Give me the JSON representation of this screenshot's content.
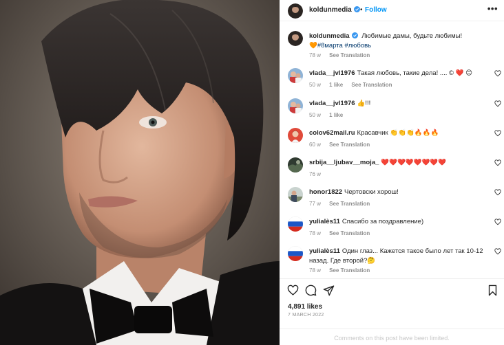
{
  "post": {
    "username": "koldunmedia",
    "follow_label": "Follow",
    "dot": "•",
    "more_label": "•••",
    "photo_alt": "Portrait photo"
  },
  "caption": {
    "username": "koldunmedia",
    "text": "Любимые дамы, будьте любимы!",
    "hashtags": "🧡#8марта #любовь",
    "time": "78 w",
    "see_translation": "See Translation"
  },
  "comments": [
    {
      "username": "vlada__jvl1976",
      "text": "Такая любовь, такие дела! .... © ❤️ 😊",
      "time": "50 w",
      "likes": "1 like",
      "see_translation": "See Translation",
      "avatar": "photo"
    },
    {
      "username": "vlada__jvl1976",
      "text": "👍!!!",
      "time": "50 w",
      "likes": "1 like",
      "see_translation": "",
      "avatar": "photo"
    },
    {
      "username": "colov62mail.ru",
      "text": "Красавчик 👏👏👏🔥🔥🔥",
      "time": "60 w",
      "likes": "",
      "see_translation": "See Translation",
      "avatar": "red"
    },
    {
      "username": "srbija__ljubav__moja_",
      "text": "❤️❤️❤️❤️❤️❤️❤️❤️",
      "time": "76 w",
      "likes": "",
      "see_translation": "",
      "avatar": "dark"
    },
    {
      "username": "honor1822",
      "text": "Чертовски хорош!",
      "time": "77 w",
      "likes": "",
      "see_translation": "See Translation",
      "avatar": "outdoor"
    },
    {
      "username": "yulialès11",
      "text": "Спасибо за поздравление)",
      "time": "78 w",
      "likes": "",
      "see_translation": "See Translation",
      "avatar": "flag"
    },
    {
      "username": "yulialès11",
      "text": "Один глаз... Кажется такое было лет так 10-12 назад. Где второй?🤔",
      "time": "78 w",
      "likes": "",
      "see_translation": "See Translation",
      "avatar": "flag"
    }
  ],
  "footer": {
    "likes": "4,891 likes",
    "date": "7 MARCH 2022",
    "limited": "Comments on this post have been limited."
  },
  "colors": {
    "accent": "#0095f6",
    "verified": "#3897f0",
    "hashtag": "#00376b",
    "secondary_text": "#8e8e8e"
  },
  "icons": [
    "verified-badge-icon",
    "more-options-icon",
    "heart-icon",
    "comment-icon",
    "share-icon",
    "bookmark-icon"
  ]
}
